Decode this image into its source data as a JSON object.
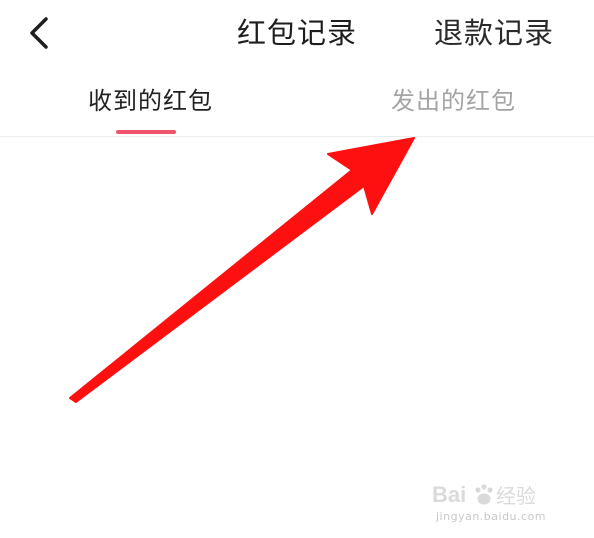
{
  "header": {
    "back_icon": "chevron-left-icon",
    "title": "红包记录",
    "refund_label": "退款记录"
  },
  "tabs": [
    {
      "label": "收到的红包",
      "active": true
    },
    {
      "label": "发出的红包",
      "active": false
    }
  ],
  "colors": {
    "accent": "#f0546d",
    "arrow": "#ff1010",
    "text_primary": "#1e1e1e",
    "text_inactive": "#a4a4a4"
  },
  "annotation": {
    "type": "arrow",
    "points_to": "发出的红包"
  },
  "watermark": {
    "logo_text": "Bai经验",
    "url": "jingyan.baidu.com"
  }
}
